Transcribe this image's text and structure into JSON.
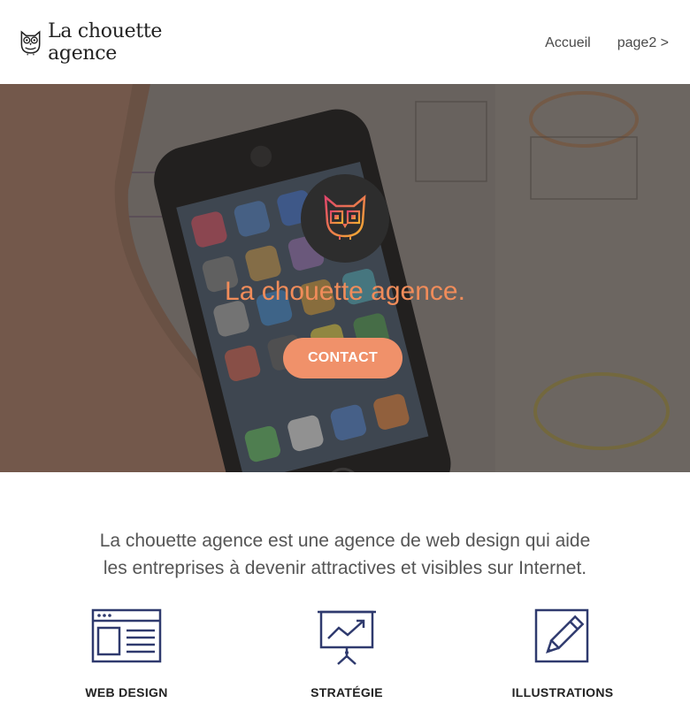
{
  "brand": {
    "name": "La chouette agence",
    "accent": "#f08c5a",
    "owl_icon": "owl-icon"
  },
  "nav": {
    "items": [
      {
        "label": "Accueil"
      },
      {
        "label": "page2 >"
      }
    ]
  },
  "hero": {
    "title": "La chouette agence.",
    "cta_label": "CONTACT"
  },
  "intro": {
    "line1": "La chouette agence est une agence de web design qui aide",
    "line2": "les entreprises à devenir attractives et visibles sur Internet."
  },
  "services": [
    {
      "label": "WEB DESIGN",
      "icon": "browser-window-icon"
    },
    {
      "label": "STRATÉGIE",
      "icon": "presentation-chart-icon"
    },
    {
      "label": "ILLUSTRATIONS",
      "icon": "pencil-icon"
    }
  ]
}
